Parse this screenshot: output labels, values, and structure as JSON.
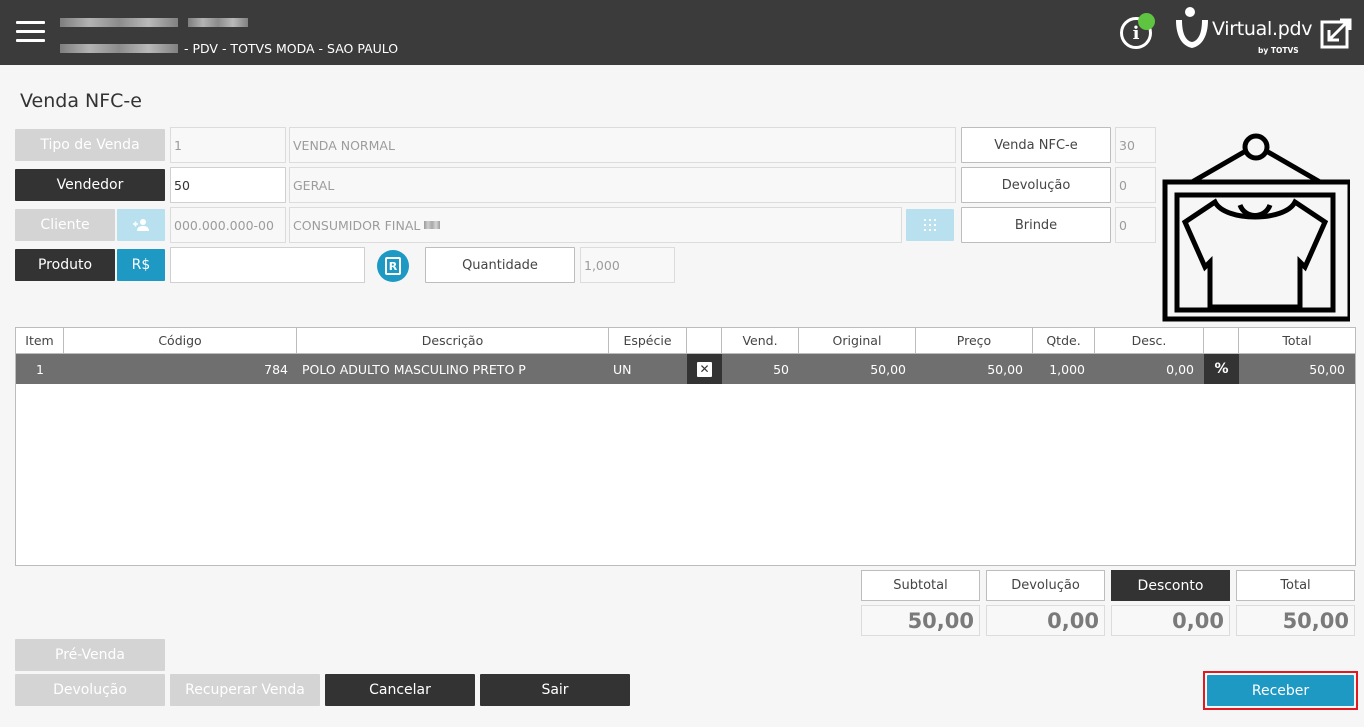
{
  "header": {
    "store_name_redacted": "",
    "store_subtitle": "- PDV - TOTVS MODA - SAO PAULO",
    "logo_text": "Virtual.pdv",
    "logo_sub": "by TOTVS"
  },
  "page": {
    "title": "Venda NFC-e"
  },
  "form": {
    "tipo_venda": {
      "label": "Tipo de Venda",
      "code": "1",
      "description": "VENDA NORMAL"
    },
    "vendedor": {
      "label": "Vendedor",
      "code": "50",
      "description": "GERAL"
    },
    "cliente": {
      "label": "Cliente",
      "document": "000.000.000-00",
      "description": "CONSUMIDOR FINAL"
    },
    "produto": {
      "label": "Produto",
      "price_button": "R$",
      "value": ""
    },
    "quantidade": {
      "label": "Quantidade",
      "value": "1,000"
    }
  },
  "counters": [
    {
      "label": "Venda NFC-e",
      "value": "30"
    },
    {
      "label": "Devolução",
      "value": "0"
    },
    {
      "label": "Brinde",
      "value": "0"
    }
  ],
  "grid": {
    "columns": [
      "Item",
      "Código",
      "Descrição",
      "Espécie",
      "",
      "Vend.",
      "Original",
      "Preço",
      "Qtde.",
      "Desc.",
      "",
      "Total"
    ],
    "rows": [
      {
        "item": "1",
        "codigo": "784",
        "descricao": "POLO ADULTO MASCULINO PRETO P",
        "especie": "UN",
        "remove_icon": "close-box-icon",
        "vend": "50",
        "original": "50,00",
        "preco": "50,00",
        "qtde": "1,000",
        "desc": "0,00",
        "discount_icon": "percent-icon",
        "total": "50,00"
      }
    ]
  },
  "totals": {
    "subtotal": {
      "label": "Subtotal",
      "value": "50,00"
    },
    "devolucao": {
      "label": "Devolução",
      "value": "0,00"
    },
    "desconto": {
      "label": "Desconto",
      "value": "0,00"
    },
    "total": {
      "label": "Total",
      "value": "50,00"
    }
  },
  "footer": {
    "pre_venda": "Pré-Venda",
    "devolucao": "Devolução",
    "recuperar_venda": "Recuperar Venda",
    "cancelar": "Cancelar",
    "sair": "Sair",
    "receber": "Receber"
  },
  "colors": {
    "topbar": "#3b3b3c",
    "accent_blue": "#1d99c4",
    "dark_button": "#333334",
    "disabled_button": "#d4d4d4",
    "status_online": "#5fc43f",
    "highlight_border": "#e11a22"
  }
}
